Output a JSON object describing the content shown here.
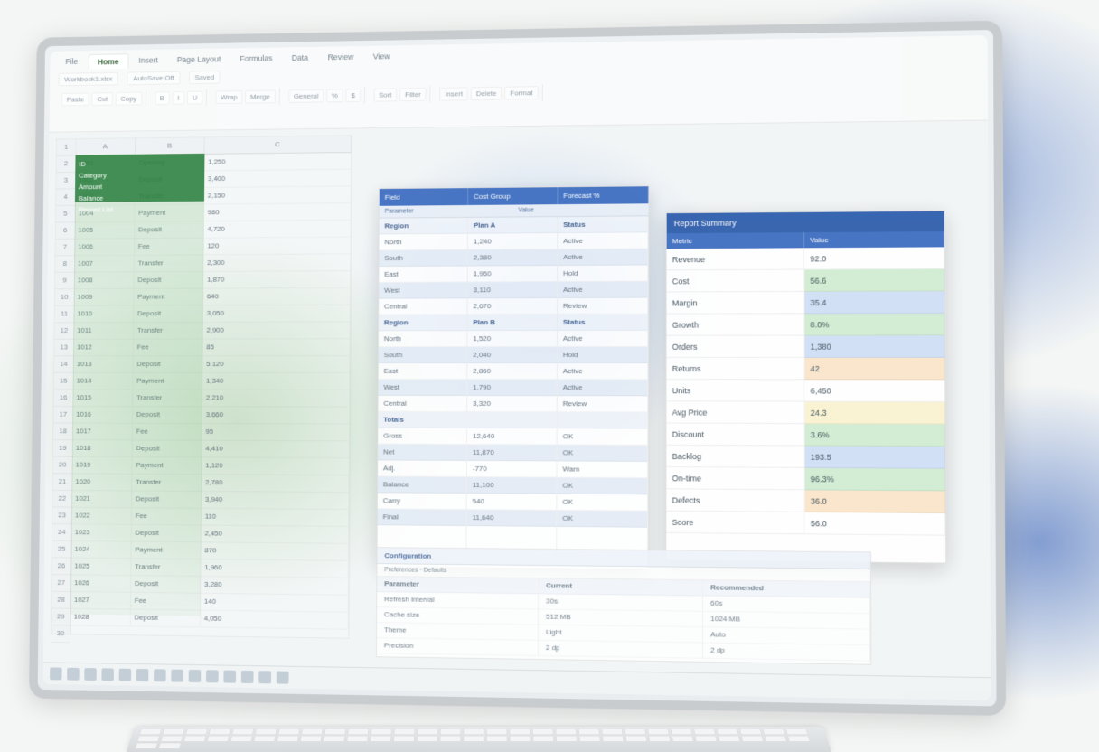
{
  "ribbon": {
    "tabs": [
      "File",
      "Home",
      "Insert",
      "Page Layout",
      "Formulas",
      "Data",
      "Review",
      "View"
    ],
    "active_tab": 1,
    "toolbar_groups": [
      [
        "Paste",
        "Cut",
        "Copy"
      ],
      [
        "B",
        "I",
        "U"
      ],
      [
        "Wrap",
        "Merge"
      ],
      [
        "General",
        "%",
        "$"
      ],
      [
        "Sort",
        "Filter"
      ],
      [
        "Insert",
        "Delete",
        "Format"
      ]
    ],
    "subbar": [
      "Workbook1.xlsx",
      "AutoSave Off",
      "Saved"
    ]
  },
  "left_sheet": {
    "col_headers": [
      "A",
      "B",
      "C"
    ],
    "green_header": [
      "ID",
      "Category",
      "Amount",
      "Balance",
      "Record List"
    ],
    "rows": [
      [
        "1001",
        "Opening",
        "1,250"
      ],
      [
        "1002",
        "Deposit",
        "3,400"
      ],
      [
        "1003",
        "Transfer",
        "2,150"
      ],
      [
        "1004",
        "Payment",
        "980"
      ],
      [
        "1005",
        "Deposit",
        "4,720"
      ],
      [
        "1006",
        "Fee",
        "120"
      ],
      [
        "1007",
        "Transfer",
        "2,300"
      ],
      [
        "1008",
        "Deposit",
        "1,870"
      ],
      [
        "1009",
        "Payment",
        "640"
      ],
      [
        "1010",
        "Deposit",
        "3,050"
      ],
      [
        "1011",
        "Transfer",
        "2,900"
      ],
      [
        "1012",
        "Fee",
        "85"
      ],
      [
        "1013",
        "Deposit",
        "5,120"
      ],
      [
        "1014",
        "Payment",
        "1,340"
      ],
      [
        "1015",
        "Transfer",
        "2,210"
      ],
      [
        "1016",
        "Deposit",
        "3,660"
      ],
      [
        "1017",
        "Fee",
        "95"
      ],
      [
        "1018",
        "Deposit",
        "4,410"
      ],
      [
        "1019",
        "Payment",
        "1,120"
      ],
      [
        "1020",
        "Transfer",
        "2,780"
      ],
      [
        "1021",
        "Deposit",
        "3,940"
      ],
      [
        "1022",
        "Fee",
        "110"
      ],
      [
        "1023",
        "Deposit",
        "2,450"
      ],
      [
        "1024",
        "Payment",
        "870"
      ],
      [
        "1025",
        "Transfer",
        "1,960"
      ],
      [
        "1026",
        "Deposit",
        "3,280"
      ],
      [
        "1027",
        "Fee",
        "140"
      ],
      [
        "1028",
        "Deposit",
        "4,050"
      ]
    ]
  },
  "center_panel": {
    "headers": [
      "Field",
      "Cost Group",
      "Forecast %"
    ],
    "sub": [
      "Parameter",
      "Value"
    ],
    "col1": [
      "Region",
      "North",
      "South",
      "East",
      "West",
      "Central",
      "Region",
      "North",
      "South",
      "East",
      "West",
      "Central",
      "Totals",
      "Gross",
      "Net",
      "Adj.",
      "Balance",
      "Carry",
      "Final"
    ],
    "col2": [
      "Plan A",
      "1,240",
      "2,380",
      "1,950",
      "3,110",
      "2,670",
      "Plan B",
      "1,520",
      "2,040",
      "2,860",
      "1,790",
      "3,320",
      "",
      "12,640",
      "11,870",
      "-770",
      "11,100",
      "540",
      "11,640"
    ],
    "col3": [
      "Status",
      "Active",
      "Active",
      "Hold",
      "Active",
      "Review",
      "Status",
      "Active",
      "Hold",
      "Active",
      "Active",
      "Review",
      "",
      "OK",
      "OK",
      "Warn",
      "OK",
      "OK",
      "OK"
    ]
  },
  "right_panel": {
    "title": "Report Summary",
    "headers": [
      "Metric",
      "Value"
    ],
    "rows": [
      [
        "Revenue",
        "92.0",
        ""
      ],
      [
        "Cost",
        "56.6",
        "g"
      ],
      [
        "Margin",
        "35.4",
        "b"
      ],
      [
        "Growth",
        "8.0%",
        "g"
      ],
      [
        "Orders",
        "1,380",
        "b"
      ],
      [
        "Returns",
        "42",
        "o"
      ],
      [
        "Units",
        "6,450",
        ""
      ],
      [
        "Avg Price",
        "24.3",
        "y"
      ],
      [
        "Discount",
        "3.6%",
        "g"
      ],
      [
        "Backlog",
        "193.5",
        "b"
      ],
      [
        "On-time",
        "96.3%",
        "g"
      ],
      [
        "Defects",
        "36.0",
        "o"
      ],
      [
        "Score",
        "56.0",
        ""
      ]
    ]
  },
  "bottom_panel": {
    "title": "Configuration",
    "sub": "Preferences · Defaults",
    "header_row": [
      "Parameter",
      "Current",
      "Recommended"
    ],
    "rows": [
      [
        "Refresh interval",
        "30s",
        "60s"
      ],
      [
        "Cache size",
        "512 MB",
        "1024 MB"
      ],
      [
        "Theme",
        "Light",
        "Auto"
      ],
      [
        "Precision",
        "2 dp",
        "2 dp"
      ]
    ]
  },
  "taskbar": {
    "icons": 14
  }
}
